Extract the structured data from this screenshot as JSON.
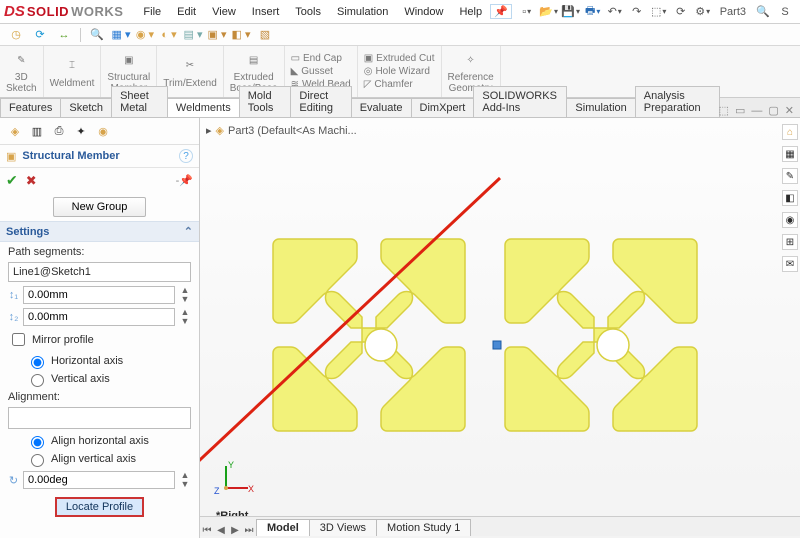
{
  "app": {
    "title_part1": "SOLID",
    "title_part2": "WORKS",
    "doc_name": "Part3"
  },
  "menu": {
    "file": "File",
    "edit": "Edit",
    "view": "View",
    "insert": "Insert",
    "tools": "Tools",
    "simulation": "Simulation",
    "window": "Window",
    "help": "Help"
  },
  "ribbon": {
    "sketch3d": "3D\nSketch",
    "weldment": "Weldment",
    "structural": "Structural\nMember",
    "trim": "Trim/Extend",
    "extruded": "Extruded\nBoss/Base",
    "endcap": "End Cap",
    "gusset": "Gusset",
    "weldbead": "Weld Bead",
    "extcut": "Extruded Cut",
    "holewiz": "Hole Wizard",
    "chamfer": "Chamfer",
    "refgeo": "Reference\nGeometry"
  },
  "tabs": {
    "features": "Features",
    "sketch": "Sketch",
    "sheetmetal": "Sheet Metal",
    "weldments": "Weldments",
    "moldtools": "Mold Tools",
    "directedit": "Direct Editing",
    "evaluate": "Evaluate",
    "dimxpert": "DimXpert",
    "addins": "SOLIDWORKS Add-Ins",
    "simulation": "Simulation",
    "analysis": "Analysis Preparation"
  },
  "fm": {
    "title": "Structural Member",
    "new_group": "New Group",
    "settings": "Settings",
    "path_seg_label": "Path segments:",
    "path_seg_value": "Line1@Sketch1",
    "dim1": "0.00mm",
    "dim2": "0.00mm",
    "mirror": "Mirror profile",
    "horiz": "Horizontal axis",
    "vert": "Vertical axis",
    "alignment": "Alignment:",
    "align_h": "Align horizontal axis",
    "align_v": "Align vertical axis",
    "angle": "0.00deg",
    "locate": "Locate Profile"
  },
  "crumb": {
    "text": "Part3  (Default<As Machi..."
  },
  "view_name": "*Right",
  "bottom_tabs": {
    "model": "Model",
    "views3d": "3D Views",
    "motion": "Motion Study 1"
  },
  "colors": {
    "profile": "#f2f27a",
    "profile_stroke": "#d8d040",
    "accent": "#2a5a9a"
  }
}
